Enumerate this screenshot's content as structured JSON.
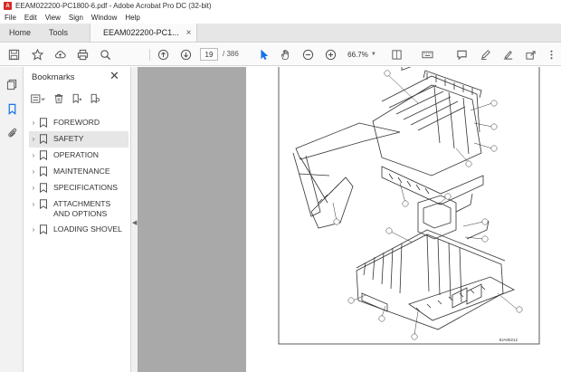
{
  "window": {
    "title": "EEAM022200-PC1800-6.pdf - Adobe Acrobat Pro DC (32-bit)",
    "logo_letter": "A"
  },
  "menu": [
    "File",
    "Edit",
    "View",
    "Sign",
    "Window",
    "Help"
  ],
  "tabs": {
    "home": "Home",
    "tools": "Tools",
    "document": "EEAM022200-PC1...",
    "close_glyph": "×"
  },
  "toolbar": {
    "current_page": "19",
    "total_pages": "/ 386",
    "zoom": "66.7%"
  },
  "bookmarks": {
    "title": "Bookmarks",
    "close_glyph": "✕",
    "items": [
      {
        "label": "FOREWORD"
      },
      {
        "label": "SAFETY"
      },
      {
        "label": "OPERATION"
      },
      {
        "label": "MAINTENANCE"
      },
      {
        "label": "SPECIFICATIONS"
      },
      {
        "label": "ATTACHMENTS AND OPTIONS"
      },
      {
        "label": "LOADING SHOVEL"
      }
    ],
    "chevron_glyph": "›"
  },
  "document": {
    "figure_code": "9JA05212",
    "callouts": [
      "1",
      "2",
      "3",
      "4",
      "5",
      "6",
      "7",
      "8",
      "9",
      "10",
      "11",
      "12"
    ]
  },
  "colors": {
    "accent": "#1473e6",
    "app_red": "#d42b24",
    "doc_gray": "#a9a9a9"
  }
}
